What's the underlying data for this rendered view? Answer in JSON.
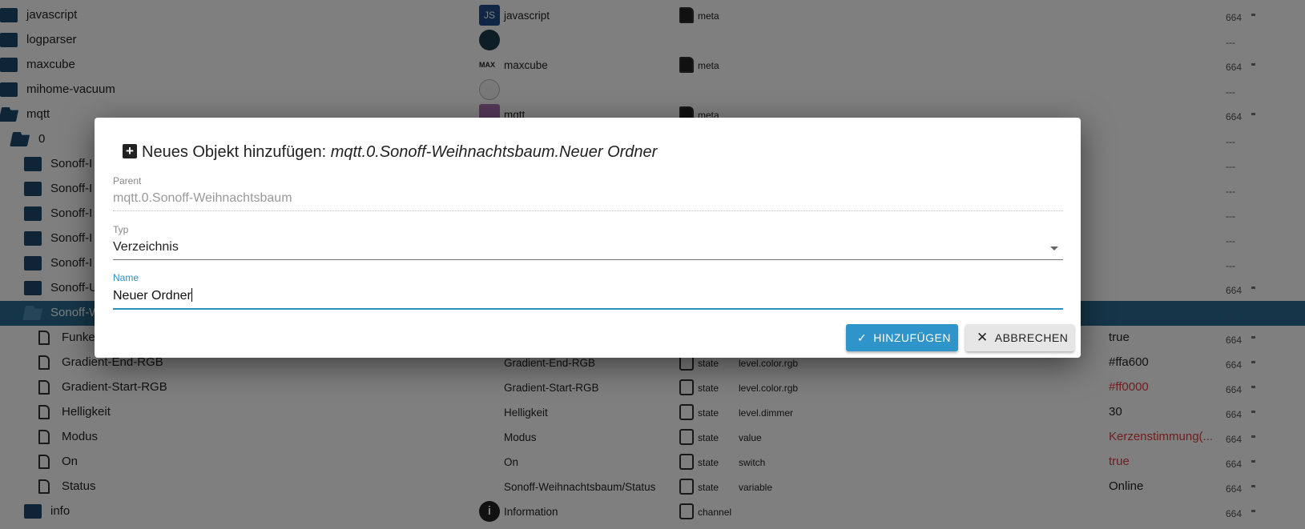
{
  "tree": {
    "rows": [
      {
        "name": "javascript",
        "level": 0,
        "kind": "folder",
        "adapter_icon": "javascript-js-icon",
        "adapter_name": "javascript",
        "type": "meta",
        "acl": "664"
      },
      {
        "name": "logparser",
        "level": 0,
        "kind": "folder",
        "adapter_icon": "logparser-icon",
        "acl": "---"
      },
      {
        "name": "maxcube",
        "level": 0,
        "kind": "folder",
        "adapter_icon": "maxcube-icon",
        "adapter_name": "maxcube",
        "type": "meta",
        "acl": "664"
      },
      {
        "name": "mihome-vacuum",
        "level": 0,
        "kind": "folder",
        "adapter_icon": "vacuum-icon",
        "acl": "---"
      },
      {
        "name": "mqtt",
        "level": 0,
        "kind": "folder-open",
        "adapter_icon": "mqtt-icon",
        "adapter_name": "mqtt",
        "type": "meta",
        "acl": "664"
      },
      {
        "name": "0",
        "level": 1,
        "kind": "folder-open",
        "acl": "---"
      },
      {
        "name": "Sonoff-I",
        "level": 2,
        "kind": "folder",
        "acl": "---"
      },
      {
        "name": "Sonoff-I",
        "level": 2,
        "kind": "folder",
        "acl": "---"
      },
      {
        "name": "Sonoff-I",
        "level": 2,
        "kind": "folder",
        "acl": "---"
      },
      {
        "name": "Sonoff-I",
        "level": 2,
        "kind": "folder",
        "acl": "---"
      },
      {
        "name": "Sonoff-I",
        "level": 2,
        "kind": "folder",
        "acl": "---"
      },
      {
        "name": "Sonoff-U",
        "level": 2,
        "kind": "folder",
        "acl": "664"
      },
      {
        "name": "Sonoff-W",
        "level": 2,
        "kind": "folder-open",
        "acl": "---",
        "selected": true
      },
      {
        "name": "Funke",
        "level": 3,
        "kind": "file",
        "value": "true",
        "acl": "664"
      },
      {
        "name": "Gradient-End-RGB",
        "level": 3,
        "kind": "file",
        "adapter_name": "Gradient-End-RGB",
        "type": "state",
        "role": "level.color.rgb",
        "value": "#ffa600",
        "acl": "664"
      },
      {
        "name": "Gradient-Start-RGB",
        "level": 3,
        "kind": "file",
        "adapter_name": "Gradient-Start-RGB",
        "type": "state",
        "role": "level.color.rgb",
        "value": "#ff0000",
        "value_red": true,
        "acl": "664"
      },
      {
        "name": "Helligkeit",
        "level": 3,
        "kind": "file",
        "adapter_name": "Helligkeit",
        "type": "state",
        "role": "level.dimmer",
        "value": "30",
        "acl": "664"
      },
      {
        "name": "Modus",
        "level": 3,
        "kind": "file",
        "adapter_name": "Modus",
        "type": "state",
        "role": "value",
        "value": "Kerzenstimmung(...",
        "value_red": true,
        "acl": "664"
      },
      {
        "name": "On",
        "level": 3,
        "kind": "file",
        "adapter_name": "On",
        "type": "state",
        "role": "switch",
        "value": "true",
        "value_red": true,
        "acl": "664"
      },
      {
        "name": "Status",
        "level": 3,
        "kind": "file",
        "adapter_name": "Sonoff-Weihnachtsbaum/Status",
        "type": "state",
        "role": "variable",
        "value": "Online",
        "acl": "664"
      },
      {
        "name": "info",
        "level": 2,
        "kind": "folder",
        "adapter_icon": "info-icon",
        "adapter_name": "Information",
        "type": "channel",
        "acl": "664"
      }
    ]
  },
  "dialog": {
    "title_prefix": "Neues Objekt hinzufügen: ",
    "title_id": "mqtt.0.Sonoff-Weihnachtsbaum.Neuer Ordner",
    "parent_label": "Parent",
    "parent_value": "mqtt.0.Sonoff-Weihnachtsbaum",
    "typ_label": "Typ",
    "typ_value": "Verzeichnis",
    "name_label": "Name",
    "name_value": "Neuer Ordner",
    "add_label": "HINZUFÜGEN",
    "cancel_label": "ABBRECHEN"
  },
  "colors": {
    "accent": "#2f94c9",
    "selected_row": "#2b6d93",
    "folder": "#1c4a70",
    "value_red": "#e03c3c"
  }
}
